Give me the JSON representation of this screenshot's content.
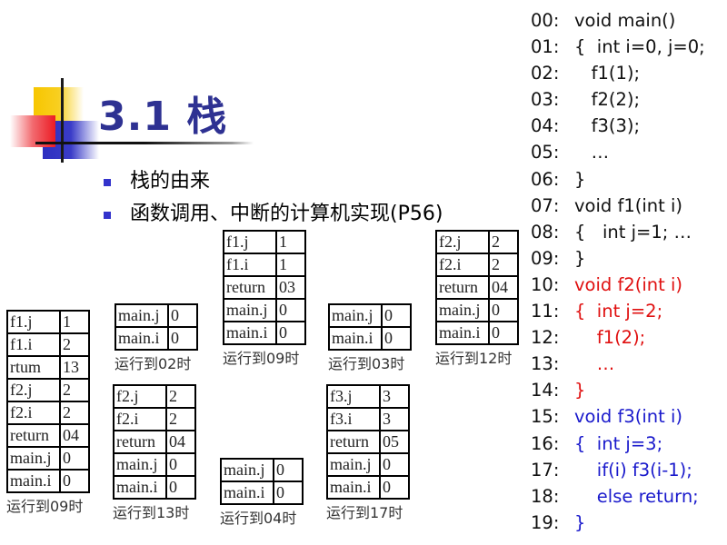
{
  "title": "3.1 栈",
  "bullets": [
    "栈的由来",
    "函数调用、中断的计算机实现(P56)"
  ],
  "colors": {
    "title": "#2e3192",
    "bullet": "#3333cc",
    "code_default": "#111111",
    "code_f2": "#e01010",
    "code_f3": "#1a1acc"
  },
  "stacks": [
    {
      "caption": "运行到02时",
      "rows": [
        {
          "key": "main.j",
          "value": "0"
        },
        {
          "key": "main.i",
          "value": "0"
        }
      ]
    },
    {
      "caption": "运行到09时",
      "rows": [
        {
          "key": "f1.j",
          "value": "1"
        },
        {
          "key": "f1.i",
          "value": "1"
        },
        {
          "key": "return",
          "value": "03"
        },
        {
          "key": "main.j",
          "value": "0"
        },
        {
          "key": "main.i",
          "value": "0"
        }
      ]
    },
    {
      "caption": "运行到03时",
      "rows": [
        {
          "key": "main.j",
          "value": "0"
        },
        {
          "key": "main.i",
          "value": "0"
        }
      ]
    },
    {
      "caption": "运行到12时",
      "rows": [
        {
          "key": "f2.j",
          "value": "2"
        },
        {
          "key": "f2.i",
          "value": "2"
        },
        {
          "key": "return",
          "value": "04"
        },
        {
          "key": "main.j",
          "value": "0"
        },
        {
          "key": "main.i",
          "value": "0"
        }
      ]
    },
    {
      "caption": "运行到09时",
      "rows": [
        {
          "key": "f1.j",
          "value": "1"
        },
        {
          "key": "f1.i",
          "value": "2"
        },
        {
          "key": "rtum",
          "value": "13"
        },
        {
          "key": "f2.j",
          "value": "2"
        },
        {
          "key": "f2.i",
          "value": "2"
        },
        {
          "key": "return",
          "value": "04"
        },
        {
          "key": "main.j",
          "value": "0"
        },
        {
          "key": "main.i",
          "value": "0"
        }
      ]
    },
    {
      "caption": "运行到13时",
      "rows": [
        {
          "key": "f2.j",
          "value": "2"
        },
        {
          "key": "f2.i",
          "value": "2"
        },
        {
          "key": "return",
          "value": "04"
        },
        {
          "key": "main.j",
          "value": "0"
        },
        {
          "key": "main.i",
          "value": "0"
        }
      ]
    },
    {
      "caption": "运行到04时",
      "rows": [
        {
          "key": "main.j",
          "value": "0"
        },
        {
          "key": "main.i",
          "value": "0"
        }
      ]
    },
    {
      "caption": "运行到17时",
      "rows": [
        {
          "key": "f3.j",
          "value": "3"
        },
        {
          "key": "f3.i",
          "value": "3"
        },
        {
          "key": "return",
          "value": "05"
        },
        {
          "key": "main.j",
          "value": "0"
        },
        {
          "key": "main.i",
          "value": "0"
        }
      ]
    }
  ],
  "code": [
    {
      "num": "00:",
      "text": "void main()",
      "color": "default"
    },
    {
      "num": "01:",
      "text": "{  int i=0, j=0;",
      "color": "default"
    },
    {
      "num": "02:",
      "text": "   f1(1);",
      "color": "default"
    },
    {
      "num": "03:",
      "text": "   f2(2);",
      "color": "default"
    },
    {
      "num": "04:",
      "text": "   f3(3);",
      "color": "default"
    },
    {
      "num": "05:",
      "text": "   …",
      "color": "default"
    },
    {
      "num": "06:",
      "text": "}",
      "color": "default"
    },
    {
      "num": "07:",
      "text": "void f1(int i)",
      "color": "default"
    },
    {
      "num": "08:",
      "text": "{   int j=1; …",
      "color": "default"
    },
    {
      "num": "09:",
      "text": "}",
      "color": "default"
    },
    {
      "num": "10:",
      "text": "void f2(int i)",
      "color": "f2"
    },
    {
      "num": "11:",
      "text": "{  int j=2;",
      "color": "f2"
    },
    {
      "num": "12:",
      "text": "    f1(2);",
      "color": "f2"
    },
    {
      "num": "13:",
      "text": "    …",
      "color": "f2"
    },
    {
      "num": "14:",
      "text": "}",
      "color": "f2"
    },
    {
      "num": "15:",
      "text": "void f3(int i)",
      "color": "f3"
    },
    {
      "num": "16:",
      "text": "{  int j=3;",
      "color": "f3"
    },
    {
      "num": "17:",
      "text": "    if(i) f3(i-1);",
      "color": "f3"
    },
    {
      "num": "18:",
      "text": "    else return;",
      "color": "f3"
    },
    {
      "num": "19:",
      "text": "}",
      "color": "f3"
    }
  ]
}
